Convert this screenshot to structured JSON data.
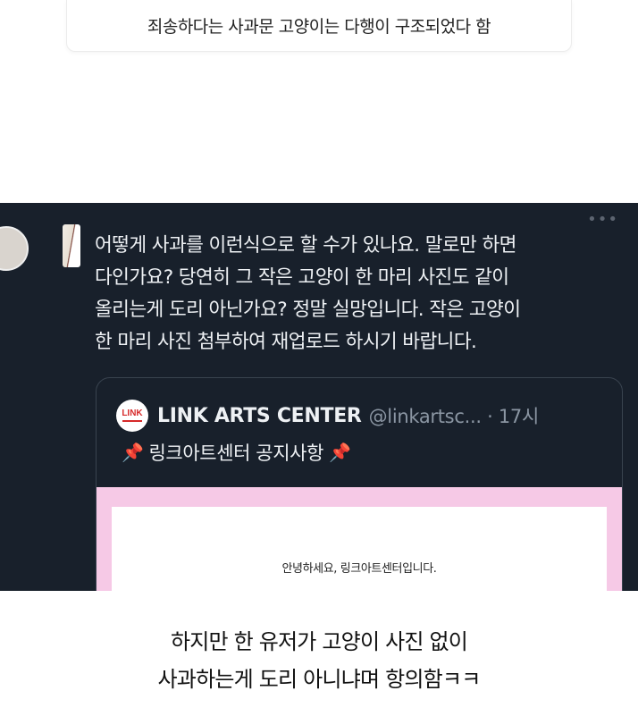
{
  "top_caption": "죄송하다는 사과문 고양이는 다행이 구조되었다 함",
  "tweet": {
    "more_icon": "more-dots-icon",
    "reply_lines": [
      "어떻게 사과를 이런식으로 할 수가 있나요. 말로만 하면",
      "다인가요? 당연히 그 작은 고양이 한 마리 사진도 같이",
      "올리는게 도리 아닌가요? 정말 실망입니다. 작은 고양이",
      "한 마리 사진 첨부하여 재업로드 하시기 바랍니다."
    ],
    "quote": {
      "logo_text": "LINK",
      "account_name": "LINK ARTS CENTER",
      "handle_time": "@linkartsc... · 17시",
      "title": "링크아트센터 공지사항",
      "pin_icon": "pushpin-icon",
      "image_text": "안녕하세요, 링크아트센터입니다."
    }
  },
  "bottom_caption": {
    "line1": "하지만 한 유저가 고양이 사진 없이",
    "line2": "사과하는게 도리 아니냐며 항의함ㅋㅋ"
  }
}
